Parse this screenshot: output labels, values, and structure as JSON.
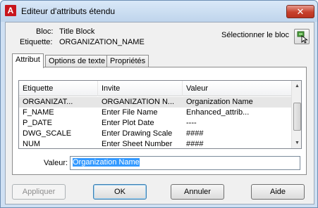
{
  "window": {
    "title": "Editeur d'attributs étendu",
    "close_glyph": "✕",
    "app_icon_glyph": "A"
  },
  "header": {
    "block_label": "Bloc:",
    "block_value": "Title Block",
    "tag_label": "Etiquette:",
    "tag_value": "ORGANIZATION_NAME",
    "select_block_label": "Sélectionner le bloc",
    "select_block_icon": "select-block-icon"
  },
  "tabs": [
    {
      "label": "Attribut",
      "active": true
    },
    {
      "label": "Options de texte",
      "active": false
    },
    {
      "label": "Propriétés",
      "active": false
    }
  ],
  "table": {
    "columns": [
      "Etiquette",
      "Invite",
      "Valeur"
    ],
    "rows": [
      {
        "tag": "ORGANIZAT...",
        "prompt": "ORGANIZATION N...",
        "value": "Organization Name",
        "selected": true
      },
      {
        "tag": "F_NAME",
        "prompt": "Enter File Name",
        "value": "Enhanced_attrib...",
        "selected": false
      },
      {
        "tag": "P_DATE",
        "prompt": "Enter Plot Date",
        "value": "----",
        "selected": false
      },
      {
        "tag": "DWG_SCALE",
        "prompt": "Enter Drawing Scale",
        "value": "####",
        "selected": false
      },
      {
        "tag": "NUM",
        "prompt": "Enter Sheet Number",
        "value": "####",
        "selected": false
      }
    ]
  },
  "value_field": {
    "label": "Valeur:",
    "value": "Organization Name"
  },
  "buttons": {
    "apply": "Appliquer",
    "ok": "OK",
    "cancel": "Annuler",
    "help": "Aide"
  },
  "colors": {
    "accent": "#c8161d",
    "selection": "#3399ff",
    "title_bar": "#cfe0f3"
  }
}
